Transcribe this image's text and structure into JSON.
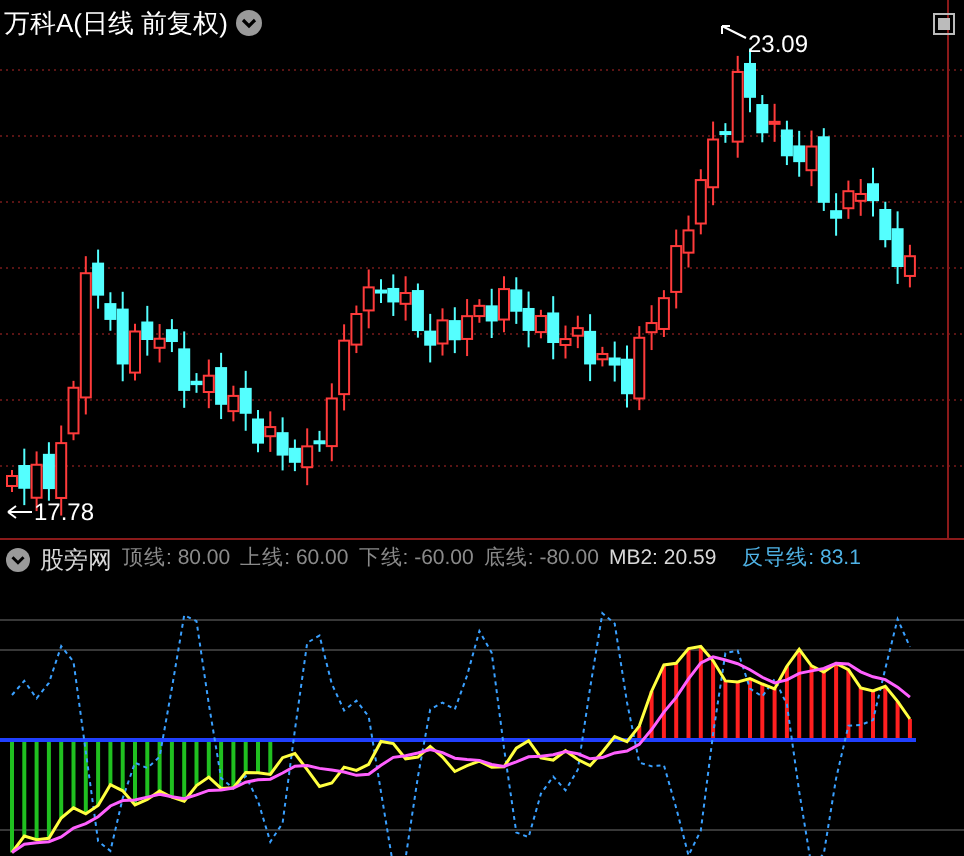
{
  "chart": {
    "title": "万科A(日线 前复权)",
    "high_label": "23.09",
    "low_label": "17.78"
  },
  "indicator": {
    "name": "股旁网",
    "params": [
      {
        "text": "顶线: 80.00",
        "color": "#8a8a8a"
      },
      {
        "text": "上线: 60.00",
        "color": "#8a8a8a"
      },
      {
        "text": "下线: -60.00",
        "color": "#8a8a8a"
      },
      {
        "text": "底线: -80.00",
        "color": "#8a8a8a"
      },
      {
        "text": "MB2: 20.59",
        "color": "#d8d8d8"
      },
      {
        "text": "反导线: 83.1",
        "color": "#4fb3e6"
      }
    ]
  }
}
